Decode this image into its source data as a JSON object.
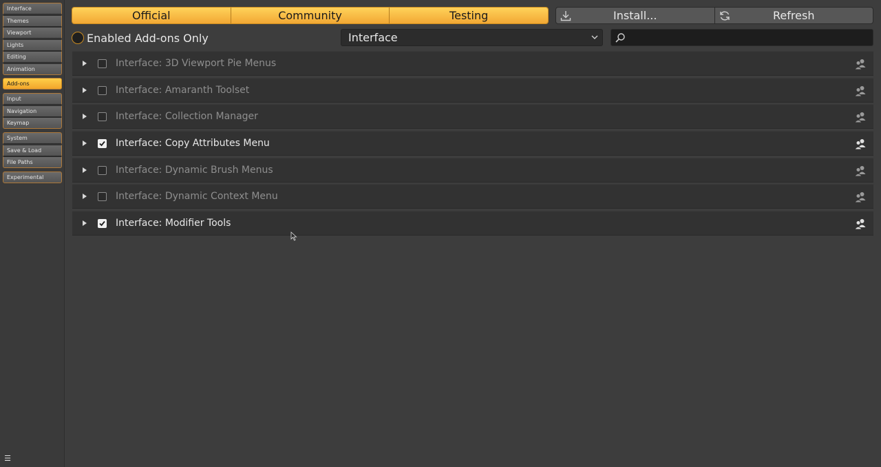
{
  "sidebar": {
    "groups": [
      [
        {
          "label": "Interface"
        },
        {
          "label": "Themes"
        },
        {
          "label": "Viewport"
        },
        {
          "label": "Lights"
        },
        {
          "label": "Editing"
        },
        {
          "label": "Animation"
        }
      ],
      [
        {
          "label": "Add-ons",
          "active": true
        }
      ],
      [
        {
          "label": "Input"
        },
        {
          "label": "Navigation"
        },
        {
          "label": "Keymap"
        }
      ],
      [
        {
          "label": "System"
        },
        {
          "label": "Save & Load"
        },
        {
          "label": "File Paths"
        }
      ],
      [
        {
          "label": "Experimental"
        }
      ]
    ],
    "menu_icon": "hamburger-menu-icon"
  },
  "tabs": [
    {
      "label": "Official"
    },
    {
      "label": "Community"
    },
    {
      "label": "Testing"
    }
  ],
  "actions": {
    "install_label": "Install...",
    "install_icon": "download-icon",
    "refresh_label": "Refresh",
    "refresh_icon": "refresh-icon"
  },
  "filter": {
    "enabled_only_label": "Enabled Add-ons Only",
    "category_selected": "Interface",
    "search_value": "",
    "search_placeholder": ""
  },
  "addons": [
    {
      "name": "Interface: 3D Viewport Pie Menus",
      "enabled": false
    },
    {
      "name": "Interface: Amaranth Toolset",
      "enabled": false
    },
    {
      "name": "Interface: Collection Manager",
      "enabled": false
    },
    {
      "name": "Interface: Copy Attributes Menu",
      "enabled": true
    },
    {
      "name": "Interface: Dynamic Brush Menus",
      "enabled": false
    },
    {
      "name": "Interface: Dynamic Context Menu",
      "enabled": false
    },
    {
      "name": "Interface: Modifier Tools",
      "enabled": true
    }
  ],
  "colors": {
    "accent": "#f2a834",
    "background": "#3d3d3d",
    "row": "#323232",
    "text_enabled": "#e8e8e8",
    "text_disabled": "#8e8e8e"
  }
}
